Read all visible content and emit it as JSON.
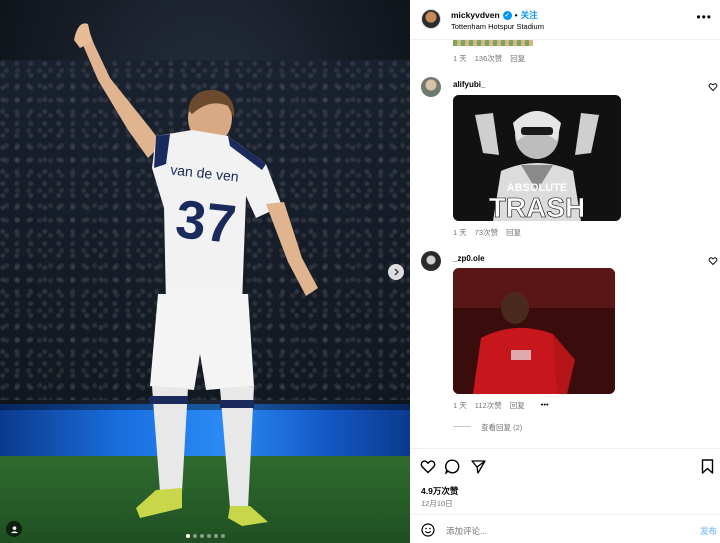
{
  "post": {
    "username": "mickyvdven",
    "follow_label": "关注",
    "location": "Tottenham Hotspur Stadium",
    "separator": "•",
    "jersey_name": "van de ven",
    "jersey_number": "37"
  },
  "comments": [
    {
      "time": "1 天",
      "likes": "136次赞",
      "reply": "回复"
    },
    {
      "username": "alifyubi_",
      "gif_text_top": "ABSOLUTE",
      "gif_text_main": "TRASH",
      "time": "1 天",
      "likes": "73次赞",
      "reply": "回复"
    },
    {
      "username": "_zp0.ole",
      "time": "1 天",
      "likes": "112次赞",
      "reply": "回复",
      "more": "•••"
    }
  ],
  "view_replies": "查看回复 (2)",
  "footer": {
    "likes": "4.9万次赞",
    "date": "12月10日",
    "add_comment_placeholder": "添加评论...",
    "post_label": "发布"
  },
  "colors": {
    "accent": "#0095f6",
    "muted": "#737373"
  },
  "carousel": {
    "count": 6,
    "active": 0
  }
}
